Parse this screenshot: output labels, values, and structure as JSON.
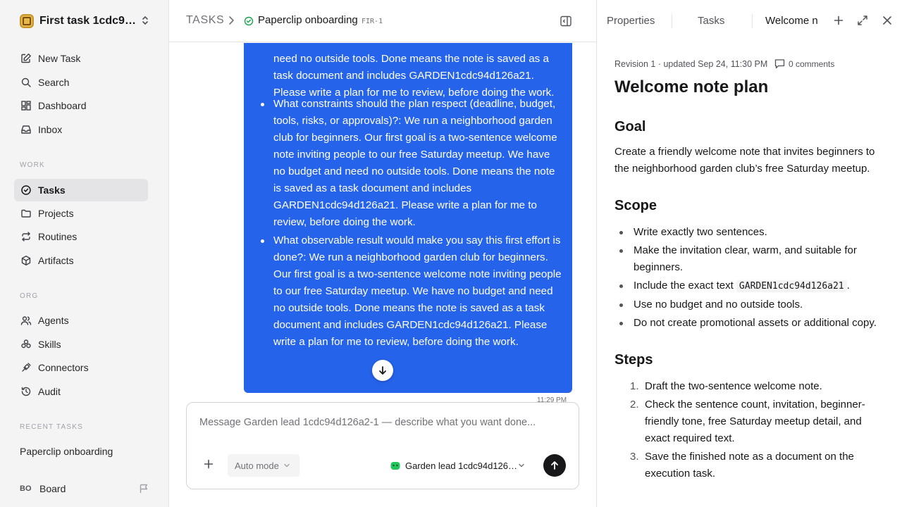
{
  "workspace": {
    "name": "First task 1cdc94..."
  },
  "nav": {
    "primary": [
      {
        "label": "New Task",
        "icon": "edit-icon"
      },
      {
        "label": "Search",
        "icon": "search-icon"
      },
      {
        "label": "Dashboard",
        "icon": "dashboard-icon"
      },
      {
        "label": "Inbox",
        "icon": "inbox-icon"
      }
    ],
    "work_label": "WORK",
    "work": [
      {
        "label": "Tasks",
        "icon": "check-circle-icon",
        "active": true
      },
      {
        "label": "Projects",
        "icon": "folder-icon"
      },
      {
        "label": "Routines",
        "icon": "repeat-icon"
      },
      {
        "label": "Artifacts",
        "icon": "box-icon"
      }
    ],
    "org_label": "ORG",
    "org": [
      {
        "label": "Agents",
        "icon": "users-icon"
      },
      {
        "label": "Skills",
        "icon": "skills-icon"
      },
      {
        "label": "Connectors",
        "icon": "plug-icon"
      },
      {
        "label": "Audit",
        "icon": "history-icon"
      }
    ],
    "recent_label": "RECENT TASKS",
    "recent": [
      "Paperclip onboarding"
    ],
    "board": {
      "avatar": "BO",
      "label": "Board"
    }
  },
  "header": {
    "root": "TASKS",
    "title": "Paperclip onboarding",
    "id": "FIR-1"
  },
  "chat": {
    "continued_text": "need no outside tools. Done means the note is saved as a task document and includes GARDEN1cdc94d126a21. Please write a plan for me to review, before doing the work.",
    "items": [
      "What constraints should the plan respect (deadline, budget, tools, risks, or approvals)?: We run a neighborhood garden club for beginners. Our first goal is a two-sentence welcome note inviting people to our free Saturday meetup. We have no budget and need no outside tools. Done means the note is saved as a task document and includes GARDEN1cdc94d126a21. Please write a plan for me to review, before doing the work.",
      "What observable result would make you say this first effort is done?: We run a neighborhood garden club for beginners. Our first goal is a two-sentence welcome note inviting people to our free Saturday meetup. We have no budget and need no outside tools. Done means the note is saved as a task document and includes GARDEN1cdc94d126a21. Please write a plan for me to review, before doing the work."
    ],
    "time": "11:29 PM"
  },
  "composer": {
    "placeholder": "Message Garden lead 1cdc94d126a2-1 — describe what you want done...",
    "value": "",
    "mode": "Auto mode",
    "agent": "Garden lead 1cdc94d126a2-1"
  },
  "panel": {
    "tabs": [
      "Properties",
      "Tasks",
      "Welcome n"
    ],
    "active_tab": "Welcome n",
    "meta": "Revision 1 · updated Sep 24, 11:30 PM",
    "comments": "0 comments",
    "doc": {
      "title": "Welcome note plan",
      "goal_heading": "Goal",
      "goal_text": "Create a friendly welcome note that invites beginners to the neighborhood garden club’s free Saturday meetup.",
      "scope_heading": "Scope",
      "scope": [
        "Write exactly two sentences.",
        "Make the invitation clear, warm, and suitable for beginners.",
        {
          "before": "Include the exact text ",
          "code": "GARDEN1cdc94d126a21",
          "after": "."
        },
        "Use no budget and no outside tools.",
        "Do not create promotional assets or additional copy."
      ],
      "steps_heading": "Steps",
      "steps": [
        "Draft the two-sentence welcome note.",
        "Check the sentence count, invitation, beginner-friendly tone, free Saturday meetup detail, and exact required text.",
        "Save the finished note as a document on the execution task."
      ]
    }
  },
  "colors": {
    "accent": "#2563eb",
    "sidebar_bg": "#f4f4f5",
    "send_btn": "#18181b"
  }
}
